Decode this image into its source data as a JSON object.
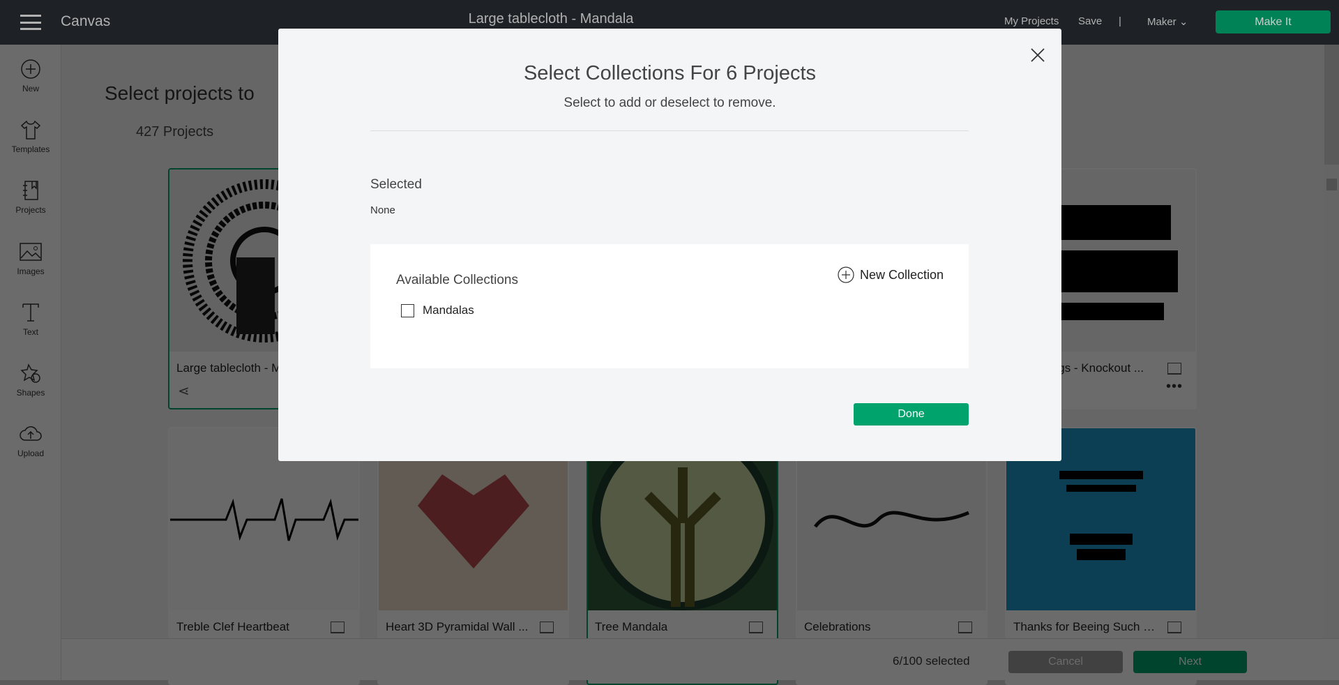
{
  "topbar": {
    "app_name": "Canvas",
    "doc_title": "Large tablecloth - Mandala",
    "my_projects": "My Projects",
    "save": "Save",
    "separator": "|",
    "machine": "Maker",
    "make_it": "Make It"
  },
  "sidebar": {
    "items": [
      {
        "label": "New",
        "icon": "plus-circle-icon"
      },
      {
        "label": "Templates",
        "icon": "shirt-icon"
      },
      {
        "label": "Projects",
        "icon": "notebook-icon"
      },
      {
        "label": "Images",
        "icon": "image-icon"
      },
      {
        "label": "Text",
        "icon": "text-icon"
      },
      {
        "label": "Shapes",
        "icon": "shapes-icon"
      },
      {
        "label": "Upload",
        "icon": "cloud-upload-icon"
      }
    ]
  },
  "main": {
    "heading": "Select projects to",
    "count": "427 Projects",
    "cards": [
      {
        "name": "Large tablecloth - Mandala",
        "selected": true
      },
      {
        "name": "",
        "selected": false
      },
      {
        "name": "",
        "selected": false
      },
      {
        "name": "",
        "selected": false
      },
      {
        "name": "Who Sings - Knockout ...",
        "selected": false
      },
      {
        "name": "Treble Clef Heartbeat",
        "selected": false
      },
      {
        "name": "Heart 3D Pyramidal Wall ...",
        "selected": false
      },
      {
        "name": "Tree Mandala",
        "selected": true
      },
      {
        "name": "Celebrations",
        "selected": false
      },
      {
        "name": "Thanks for Beeing Such a Gre...",
        "selected": false
      }
    ]
  },
  "bottombar": {
    "selected_count": "6/100 selected",
    "cancel": "Cancel",
    "next": "Next"
  },
  "modal": {
    "title": "Select Collections For 6 Projects",
    "subtitle": "Select to add or deselect to remove.",
    "selected_label": "Selected",
    "selected_value": "None",
    "available_label": "Available Collections",
    "new_collection": "New Collection",
    "collections": [
      {
        "name": "Mandalas",
        "checked": false
      }
    ],
    "done": "Done"
  },
  "colors": {
    "accent": "#00a36c",
    "topbar": "#25292e"
  }
}
